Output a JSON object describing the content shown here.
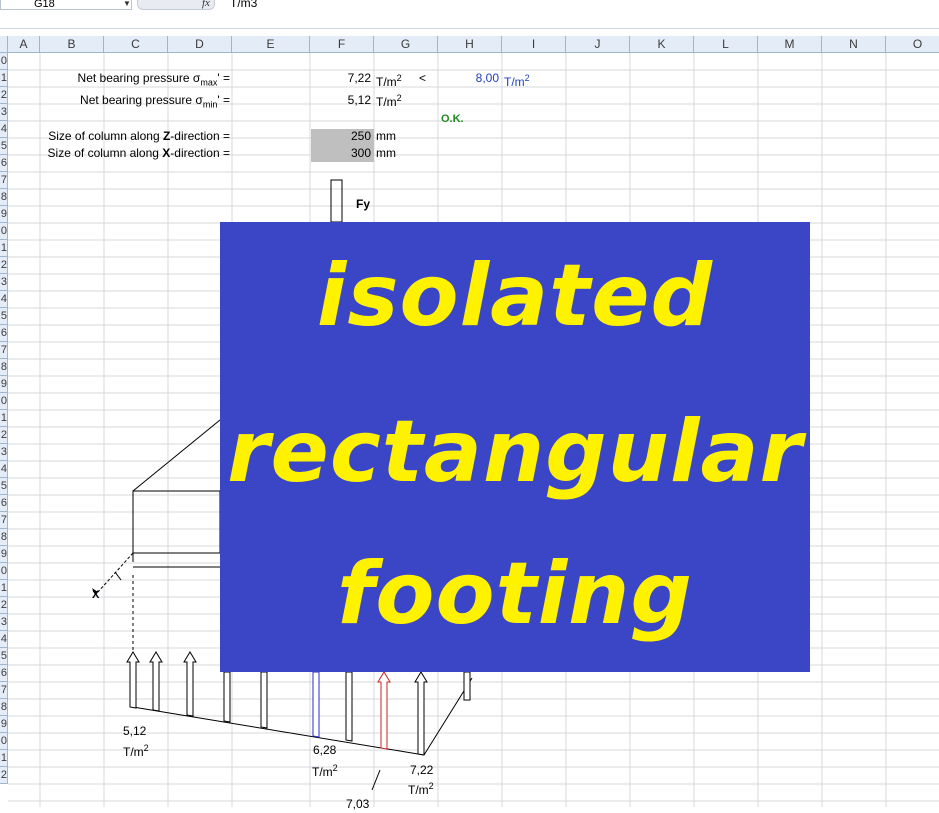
{
  "formula_bar": {
    "name_box": "G18",
    "fx": "fx",
    "formula": "T/m3"
  },
  "columns": [
    "A",
    "B",
    "C",
    "D",
    "E",
    "F",
    "G",
    "H",
    "I",
    "J",
    "K",
    "L",
    "M",
    "N",
    "O"
  ],
  "rows": [
    "0",
    "1",
    "2",
    "3",
    "4",
    "5",
    "6",
    "7",
    "8",
    "9",
    "0",
    "1",
    "2",
    "3",
    "4",
    "5",
    "6",
    "7",
    "8",
    "9",
    "0",
    "1",
    "2",
    "3",
    "4",
    "5",
    "6",
    "7",
    "8",
    "9",
    "0",
    "1",
    "2",
    "3",
    "4",
    "5",
    "6",
    "7",
    "8",
    "9",
    "0",
    "1",
    "2"
  ],
  "sheet": {
    "row1": {
      "label": "Net bearing pressure σ",
      "sub": "max",
      "suffix": "' =",
      "value": "7,22",
      "unit": "T/m",
      "unit_sup": "2",
      "compare": "<",
      "limit": "8,00",
      "limit_unit": "T/m",
      "limit_sup": "2"
    },
    "row2": {
      "label": "Net bearing pressure σ",
      "sub": "min",
      "suffix": "' =",
      "value": "5,12",
      "unit": "T/m",
      "unit_sup": "2"
    },
    "row3": {
      "status": "O.K."
    },
    "row4": {
      "label_pre": "Size of column along ",
      "label_bold": "Z",
      "label_post": "-direction =",
      "value": "250",
      "unit": "mm"
    },
    "row5": {
      "label_pre": "Size of column along ",
      "label_bold": "X",
      "label_post": "-direction =",
      "value": "300",
      "unit": "mm"
    }
  },
  "drawing": {
    "load_label": "Fy",
    "axis_label": "X",
    "p_left": "5,12",
    "p_mid": "6,28",
    "p_right": "7,22",
    "p_bottom": "7,03",
    "unit": "T/m",
    "unit_sup": "2"
  },
  "overlay": {
    "line1": "isolated",
    "line2": "rectangular",
    "line3": "footing"
  },
  "colors": {
    "overlay_bg": "#3b46c6",
    "overlay_text": "#fff200",
    "status_ok": "#1f8a1f",
    "limit_blue": "#1f3fbf"
  }
}
